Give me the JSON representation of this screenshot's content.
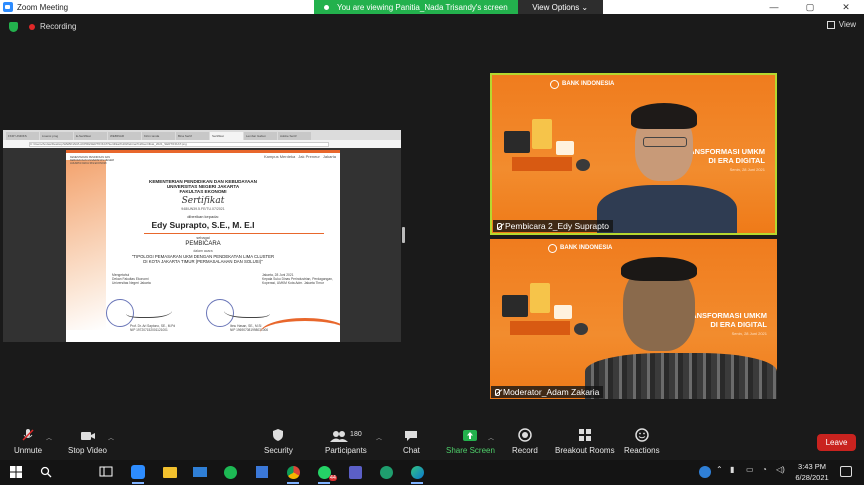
{
  "window": {
    "title": "Zoom Meeting",
    "minimize": "—",
    "maximize": "▢",
    "close": "✕"
  },
  "share_banner": {
    "text": "You are viewing Panitia_Nada Trisandy's screen",
    "options": "View Options ⌄"
  },
  "topbar": {
    "recording": "Recording",
    "view": "View"
  },
  "shared_screen": {
    "tabs": [
      "FKIP UNDIKS",
      "Lisensi prog",
      "E-Sertifikat",
      "WEBINAR",
      "Kirim tanda",
      "Bina Sertif",
      "Sertifikat",
      "Lembar Gabun",
      "Adobe Sertif"
    ],
    "url": "C:/Users/Andas/Desktop/WEBINAR/LAKPRESERTIFIKAT/Sertifikat%20Webinar%20sertifikat_2021_SERTIFIKAT.png",
    "certificate": {
      "header_left": "KEMENTERIAN PENDIDIKAN DAN KEBUDAYAAN UNIVERSITAS NEGERI JAKARTA FAKULTAS EKONOMI",
      "logos_right": [
        "Kampus Merdeka",
        "Jak Preneur",
        "Jakarta"
      ],
      "line1": "KEMENTERIAN PENDIDIKAN DAN KEBUDAYAAN",
      "line2": "UNIVERSITAS NEGERI JAKARTA",
      "line3": "FAKULTAS EKONOMI",
      "title": "Sertifikat",
      "number": "948/UN39.5.FE/TU.07/2021",
      "given_to": "diberikan kepada:",
      "name": "Edy Suprapto, S.E., M. E.I",
      "as": "sebagai",
      "role": "PEMBICARA",
      "in_event": "dalam acara",
      "topic1": "\"TIPOLOGI PEMASARAN UKM DENGAN PENDEKATAN LIMA CLUSTER",
      "topic2": "DI KOTA JAKARTA TIMUR (PERMASALAHAN DAN SOLUSI)\"",
      "topic3": "",
      "sig_left": "Mengetahui\nDekan Fakultas Ekonomi\nUniversitas Negeri Jakarta",
      "sig_right": "Jakarta, 28 Juni 2021\nKepala Suku Dinas Perindustrian, Perdagangan,\nKoperasi, UMKM Kota Adm. Jakarta Timur",
      "name_left": "Prof. Dr. Ari Saptono, SE., M.Pd\nNIP 197207152001121001",
      "name_right": "Ibnu Hasan, SE., M.Si\nNIP 196907081998031006"
    }
  },
  "participants": [
    {
      "name": "Pembicara 2_Edy Suprapto",
      "active_speaker": true,
      "background_title": "ANSFORMASI UMKM\nDI ERA DIGITAL",
      "background_date": "Senin, 28 Juni 2021",
      "bank": "BANK INDONESIA"
    },
    {
      "name": "Moderator_Adam Zakaria",
      "active_speaker": false,
      "background_title": "ANSFORMASI UMKM\nDI ERA DIGITAL",
      "background_date": "Senin, 28 Juni 2021",
      "bank": "BANK INDONESIA"
    }
  ],
  "toolbar": {
    "unmute": "Unmute",
    "stop_video": "Stop Video",
    "security": "Security",
    "participants": "Participants",
    "participants_count": "180",
    "chat": "Chat",
    "share_screen": "Share Screen",
    "record": "Record",
    "breakout_rooms": "Breakout Rooms",
    "reactions": "Reactions",
    "leave": "Leave"
  },
  "taskbar": {
    "whatsapp_badge": "44",
    "time": "3:43 PM",
    "date": "6/28/2021"
  },
  "colors": {
    "accent_green": "#23b14d",
    "leave_red": "#c9231f",
    "speaker_border": "#b6d82f",
    "orange": "#f07c1e"
  }
}
